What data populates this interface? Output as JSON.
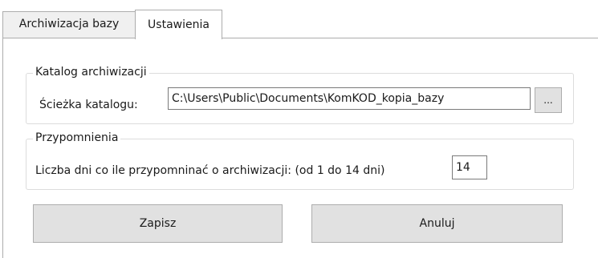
{
  "tabs": {
    "archive_label": "Archiwizacja bazy",
    "settings_label": "Ustawienia"
  },
  "catalog_group": {
    "legend": "Katalog archiwizacji",
    "path_label": "Ścieżka katalogu:",
    "path_value": "C:\\Users\\Public\\Documents\\KomKOD_kopia_bazy",
    "browse_label": "..."
  },
  "reminders_group": {
    "legend": "Przypomnienia",
    "days_label": "Liczba dni co ile przypomninać o archiwizacji: (od 1 do 14 dni)",
    "days_value": "14"
  },
  "actions": {
    "save_label": "Zapisz",
    "cancel_label": "Anuluj"
  }
}
